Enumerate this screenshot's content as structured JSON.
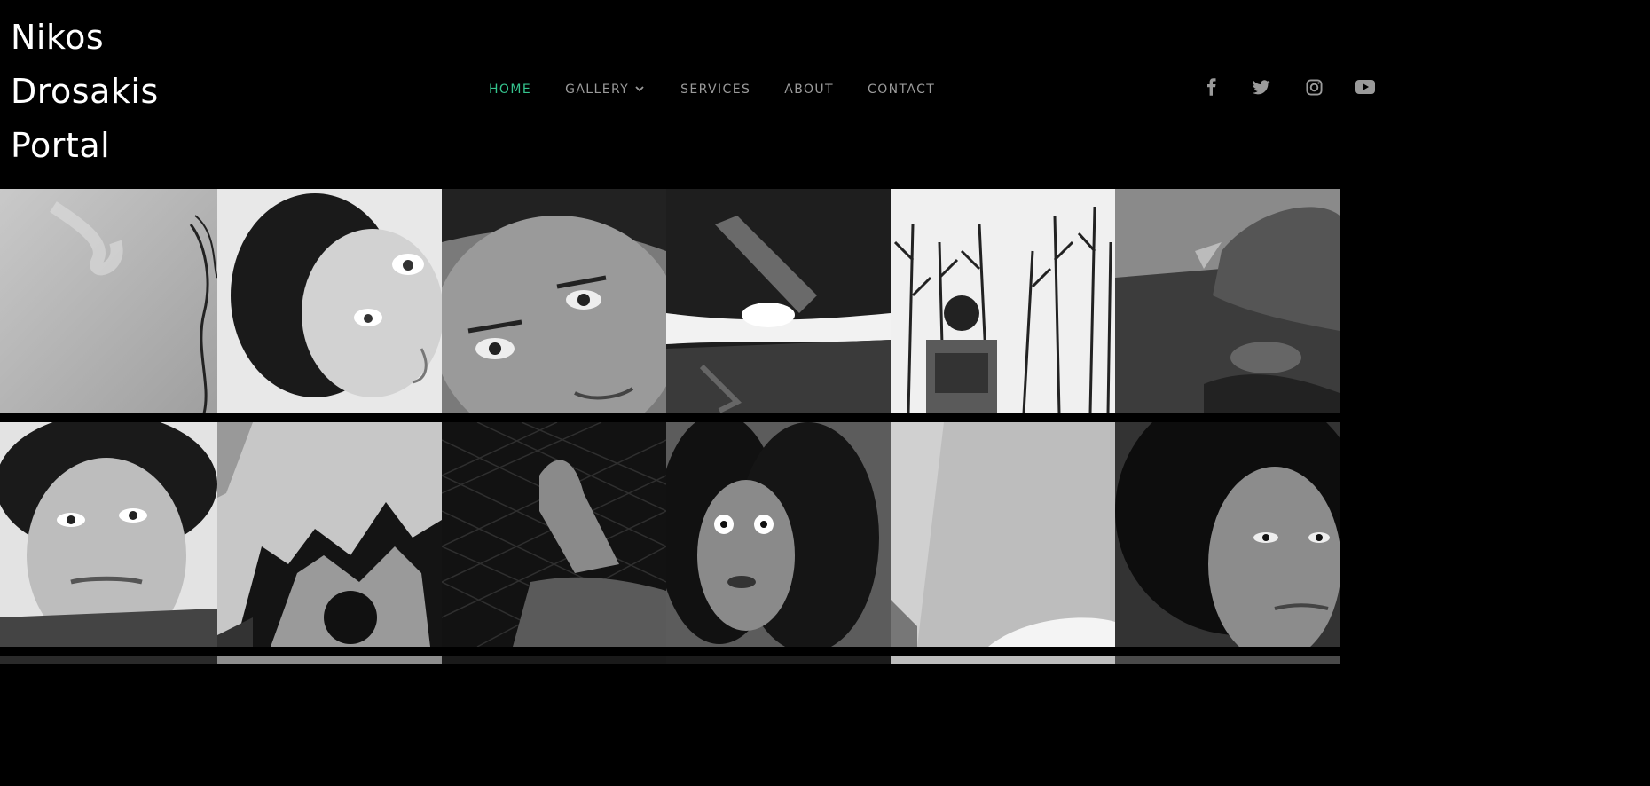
{
  "site": {
    "title_lines": [
      "Nikos",
      "Drosakis",
      "Portal"
    ]
  },
  "nav": {
    "items": [
      {
        "label": "HOME",
        "active": true
      },
      {
        "label": "GALLERY",
        "has_dropdown": true
      },
      {
        "label": "SERVICES"
      },
      {
        "label": "ABOUT"
      },
      {
        "label": "CONTACT"
      }
    ]
  },
  "social": [
    "facebook-icon",
    "twitter-icon",
    "instagram-icon",
    "youtube-icon"
  ],
  "colors": {
    "background": "#000000",
    "nav_text": "#9a9a9a",
    "accent": "#35c48e",
    "title": "#ffffff"
  }
}
